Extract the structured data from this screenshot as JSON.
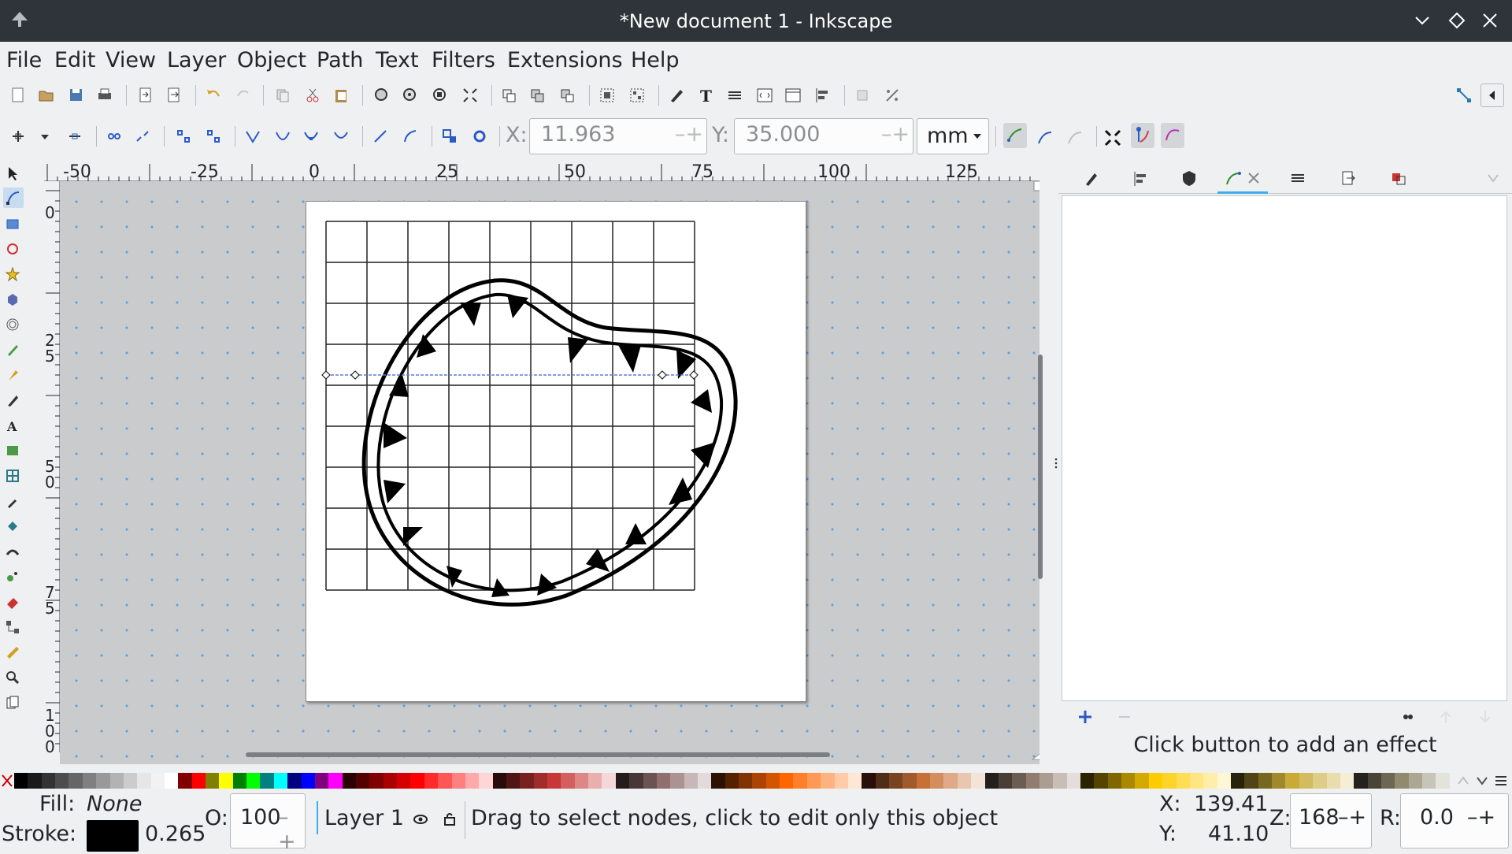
{
  "window": {
    "title": "*New document 1 - Inkscape"
  },
  "menu": [
    "File",
    "Edit",
    "View",
    "Layer",
    "Object",
    "Path",
    "Text",
    "Filters",
    "Extensions",
    "Help"
  ],
  "node_toolbar": {
    "x_label": "X:",
    "x_value": "11.963",
    "y_label": "Y:",
    "y_value": "35.000",
    "unit": "mm"
  },
  "rulers": {
    "horizontal_ticks": [
      "-50",
      "-25",
      "0",
      "25",
      "50",
      "75",
      "100",
      "125"
    ],
    "vertical_ticks": [
      "0",
      "25",
      "50",
      "75",
      "100"
    ]
  },
  "dock": {
    "hint": "Click button to add an effect"
  },
  "palette": [
    "#000000",
    "#1a1a1a",
    "#333333",
    "#4d4d4d",
    "#666666",
    "#808080",
    "#999999",
    "#b3b3b3",
    "#cccccc",
    "#e6e6e6",
    "#f2f2f2",
    "#ffffff",
    "#800000",
    "#ff0000",
    "#808000",
    "#ffff00",
    "#008000",
    "#00ff00",
    "#008080",
    "#00ffff",
    "#000080",
    "#0000ff",
    "#800080",
    "#ff00ff",
    "#2b0000",
    "#550000",
    "#800000",
    "#aa0000",
    "#d40000",
    "#ff0000",
    "#ff2a2a",
    "#ff5555",
    "#ff8080",
    "#ffaaaa",
    "#ffd5d5",
    "#280b0b",
    "#501616",
    "#782121",
    "#a02c2c",
    "#c83737",
    "#d35f5f",
    "#de8787",
    "#e9afaf",
    "#f4d7d7",
    "#241c1c",
    "#483737",
    "#6c5353",
    "#916f6f",
    "#ac9393",
    "#c8b7b7",
    "#e3dbdb",
    "#2b1100",
    "#552200",
    "#803300",
    "#aa4400",
    "#d45500",
    "#ff6600",
    "#ff7f2a",
    "#ff9955",
    "#ffb380",
    "#ffccaa",
    "#ffe6d5",
    "#280f0b",
    "#502d16",
    "#784421",
    "#a05a2c",
    "#c87137",
    "#d38d5f",
    "#deaa87",
    "#e9c6af",
    "#f4e3d7",
    "#241f1c",
    "#483e37",
    "#6c5d53",
    "#917c6f",
    "#ac9d93",
    "#c8beb7",
    "#e3dedb",
    "#2b2200",
    "#554400",
    "#806600",
    "#aa8800",
    "#d4aa00",
    "#ffcc00",
    "#ffd42a",
    "#ffdd55",
    "#ffe680",
    "#ffeeaa",
    "#fff6d5",
    "#28220b",
    "#504416",
    "#786721",
    "#a0892c",
    "#c8ab37",
    "#d3bc5f",
    "#decd87",
    "#e9ddaf",
    "#f4eed7",
    "#24221c",
    "#484537",
    "#6c6753",
    "#918a6f",
    "#aca793",
    "#c8c4b7",
    "#e3e2db"
  ],
  "status": {
    "fill_label": "Fill:",
    "fill_value": "None",
    "stroke_label": "Stroke:",
    "stroke_width": "0.265",
    "opacity_label": "O:",
    "opacity_value": "100",
    "layer": "Layer 1",
    "message": "Drag to select nodes, click to edit only this object",
    "cursor_x_label": "X:",
    "cursor_x": "139.41",
    "cursor_y_label": "Y:",
    "cursor_y": "41.10",
    "zoom_label": "Z:",
    "zoom": "168",
    "rotate_label": "R:",
    "rotate": "0.0"
  }
}
